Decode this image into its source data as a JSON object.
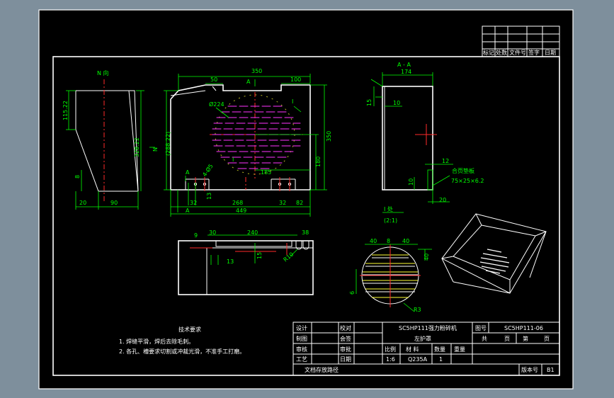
{
  "views": {
    "n_view_label": "N 向",
    "aa_label": "A - A",
    "detail_label": "I 处",
    "detail_scale": "(2:1)",
    "n_arrow": "N",
    "section_a": "A",
    "section_mark": "I"
  },
  "dims": {
    "left_h1": "115.22",
    "left_h2": "328.22",
    "left_w1": "20",
    "left_w2": "90",
    "left_8": "8",
    "top_350": "350",
    "top_50": "50",
    "top_100": "100",
    "dia_224": "Ø224",
    "h_288": "(288.22)",
    "h_350": "350",
    "h_180": "180",
    "h_185": "185",
    "h_13": "13",
    "w_32a": "32",
    "w_268": "268",
    "w_32b": "32",
    "w_82": "82",
    "w_449": "449",
    "holes_4": "4-Ø5",
    "aa_174": "174",
    "aa_15": "15",
    "aa_10": "10",
    "aa_10b": "10",
    "aa_12": "12",
    "aa_20": "20",
    "hinge": "合页垫板",
    "hinge_size": "75×25×6.2",
    "bot_30": "30",
    "bot_240": "240",
    "bot_38": "38",
    "bot_9": "9",
    "bot_15": "15",
    "bot_13": "13",
    "bot_r10": "R10",
    "c_40a": "40",
    "c_8": "8",
    "c_40b": "40",
    "c_40c": "40",
    "c_6": "6",
    "c_r3": "R3"
  },
  "notes": {
    "title": "技术要求",
    "line1": "1. 焊缝平滑，焊后去除毛刺。",
    "line2": "2. 各孔、槽要求切割或冲裁光滑，不准手工打磨。"
  },
  "revision": {
    "h1": "标记",
    "h2": "处数",
    "h3": "文件号",
    "h4": "签字",
    "h5": "日期"
  },
  "title_block": {
    "design": "设计",
    "draw": "制图",
    "review": "审核",
    "process": "工艺",
    "check": "校对",
    "standard": "会签",
    "approve": "审批",
    "date": "日期",
    "product": "SC5HP111强力粉碎机",
    "part": "左护罩",
    "drawing_no_label": "图号",
    "drawing_no": "SC5HP111-06",
    "total": "共",
    "pages": "页",
    "sheet": "第",
    "sheet_pages": "页",
    "scale_label": "比例",
    "material_label": "材 料",
    "qty_label": "数量",
    "weight_label": "重量",
    "scale": "1:6",
    "material": "Q235A",
    "qty": "1",
    "doc_path": "文档存放路径",
    "version_label": "版本号",
    "version": "B1"
  },
  "colors": {
    "background": "#000000",
    "frame": "#ffffff",
    "dimension": "#00ff00",
    "centerline": "#ff2a2a",
    "slot": "#ff33ff",
    "outer": "#7e8f9c"
  }
}
